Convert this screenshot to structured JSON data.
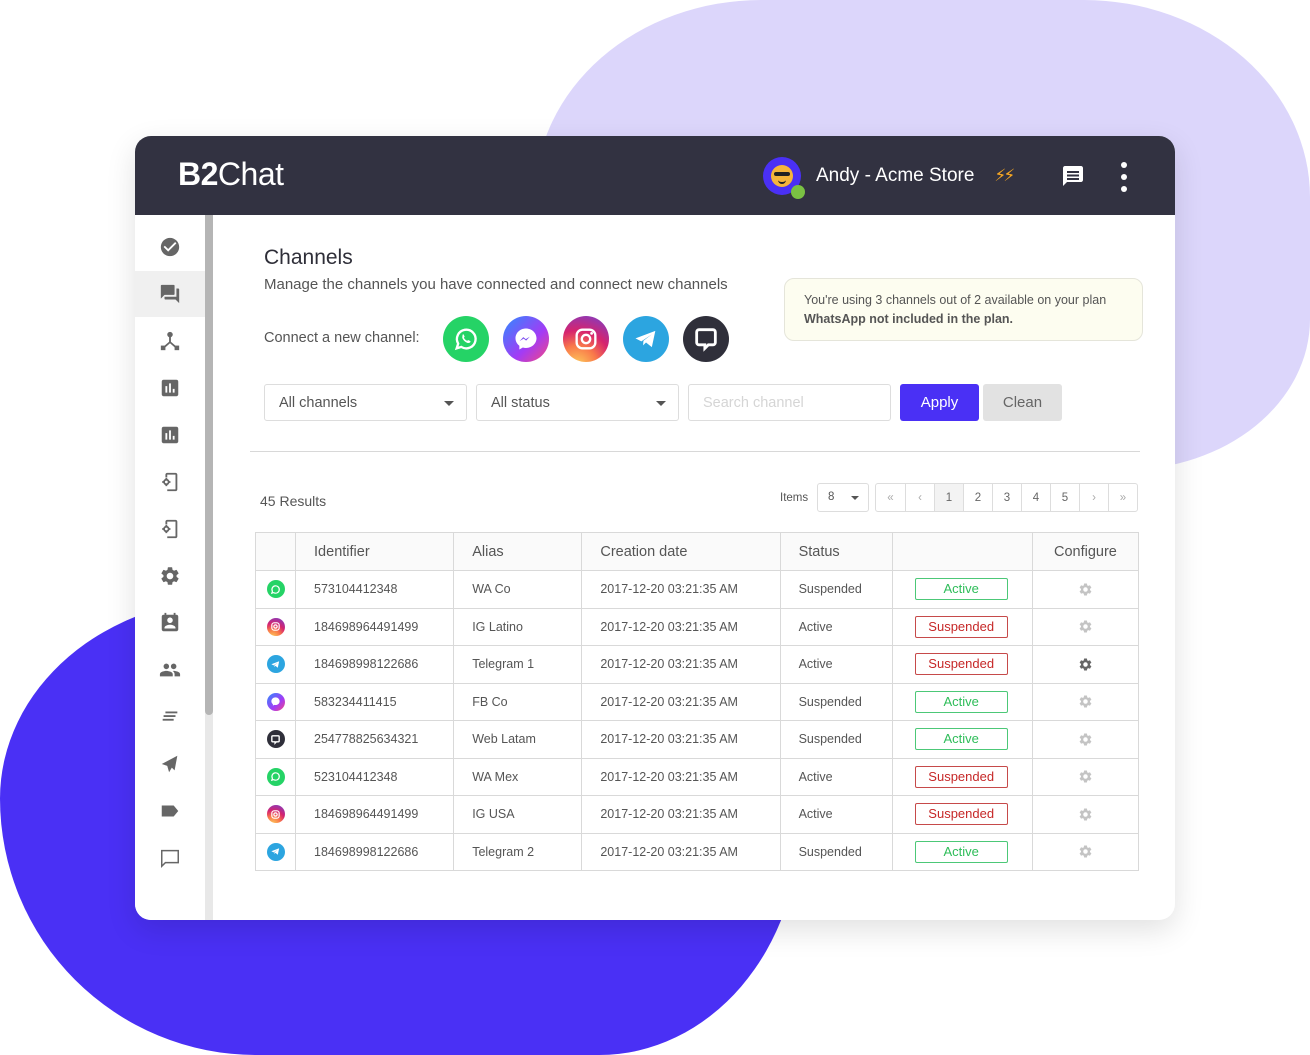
{
  "colors": {
    "brand": "#4a30f5",
    "topbar": "#323241",
    "active_green": "#2ebd59",
    "suspended_red": "#c62828",
    "blob_light": "#dcd6fb"
  },
  "header": {
    "logo_b2": "B2",
    "logo_chat": "Chat",
    "user_name": "Andy - Acme Store",
    "bolts": "⚡⚡",
    "icons": [
      "avatar",
      "lightning-icon",
      "chat-icon",
      "more-vertical-icon"
    ]
  },
  "sidebar": {
    "items": [
      {
        "icon": "check-circle-icon",
        "active": false
      },
      {
        "icon": "conversations-icon",
        "active": true
      },
      {
        "icon": "hierarchy-icon",
        "active": false
      },
      {
        "icon": "bar-chart-icon",
        "active": false
      },
      {
        "icon": "bar-chart-icon",
        "active": false
      },
      {
        "icon": "device-settings-icon",
        "active": false
      },
      {
        "icon": "device-settings-icon",
        "active": false
      },
      {
        "icon": "gear-icon",
        "active": false
      },
      {
        "icon": "contact-card-icon",
        "active": false
      },
      {
        "icon": "people-icon",
        "active": false
      },
      {
        "icon": "lines-icon",
        "active": false
      },
      {
        "icon": "send-icon",
        "active": false
      },
      {
        "icon": "tag-icon",
        "active": false
      },
      {
        "icon": "chat-bubble-icon",
        "active": false
      }
    ]
  },
  "page": {
    "title": "Channels",
    "subtitle": "Manage the channels you have connected and connect new channels",
    "connect_label": "Connect a new channel:",
    "connect_channels": [
      "WhatsApp",
      "Messenger",
      "Instagram",
      "Telegram",
      "Web chat"
    ]
  },
  "notice": {
    "line1": "You're using 3 channels out of 2 available on your plan",
    "line2": "WhatsApp not included in the plan."
  },
  "filters": {
    "channel_select": "All channels",
    "status_select": "All status",
    "search_placeholder": "Search channel",
    "search_value": "",
    "apply_label": "Apply",
    "clean_label": "Clean"
  },
  "results": {
    "count_label": "45 Results",
    "items_label": "Items",
    "items_per_page": "8",
    "pager": {
      "first": "«",
      "prev": "‹",
      "pages": [
        "1",
        "2",
        "3",
        "4",
        "5"
      ],
      "current": "1",
      "next": "›",
      "last": "»"
    }
  },
  "table": {
    "headers": [
      "",
      "Identifier",
      "Alias",
      "Creation date",
      "Status",
      "",
      "Configure"
    ],
    "rows": [
      {
        "channel": "whatsapp",
        "identifier": "573104412348",
        "alias": "WA Co",
        "created": "2017-12-20 03:21:35 AM",
        "status": "Suspended",
        "action": "Active",
        "gear_dark": false
      },
      {
        "channel": "instagram",
        "identifier": "184698964491499",
        "alias": "IG Latino",
        "created": "2017-12-20 03:21:35 AM",
        "status": "Active",
        "action": "Suspended",
        "gear_dark": false
      },
      {
        "channel": "telegram",
        "identifier": "184698998122686",
        "alias": "Telegram 1",
        "created": "2017-12-20 03:21:35 AM",
        "status": "Active",
        "action": "Suspended",
        "gear_dark": true
      },
      {
        "channel": "messenger",
        "identifier": "583234411415",
        "alias": "FB Co",
        "created": "2017-12-20 03:21:35 AM",
        "status": "Suspended",
        "action": "Active",
        "gear_dark": false
      },
      {
        "channel": "webchat",
        "identifier": "254778825634321",
        "alias": "Web Latam",
        "created": "2017-12-20 03:21:35 AM",
        "status": "Suspended",
        "action": "Active",
        "gear_dark": false
      },
      {
        "channel": "whatsapp",
        "identifier": "523104412348",
        "alias": "WA Mex",
        "created": "2017-12-20 03:21:35 AM",
        "status": "Active",
        "action": "Suspended",
        "gear_dark": false
      },
      {
        "channel": "instagram",
        "identifier": "184698964491499",
        "alias": "IG USA",
        "created": "2017-12-20 03:21:35 AM",
        "status": "Active",
        "action": "Suspended",
        "gear_dark": false
      },
      {
        "channel": "telegram",
        "identifier": "184698998122686",
        "alias": "Telegram 2",
        "created": "2017-12-20 03:21:35 AM",
        "status": "Suspended",
        "action": "Active",
        "gear_dark": false
      }
    ]
  }
}
